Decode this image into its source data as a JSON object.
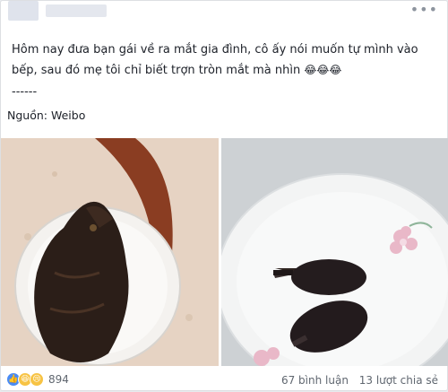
{
  "post": {
    "line1": "Hôm nay đưa bạn gái về ra mắt gia đình, cô ấy nói muốn tự mình vào",
    "line2": "bếp, sau đó mẹ tôi chỉ biết trợn tròn mắt mà nhìn",
    "emoji": "😂😂😂",
    "separator": "------",
    "source": "Nguồn: Weibo"
  },
  "reactions": {
    "count": "894",
    "icons": [
      "like-icon",
      "haha-icon",
      "sad-icon"
    ]
  },
  "stats": {
    "comments": "67 bình luận",
    "shares": "13 lượt chia sẻ"
  },
  "colors": {
    "text": "#1d2129",
    "muted": "#606770",
    "like_blue": "#4a8bf5",
    "emoji_yellow": "#f7c344"
  }
}
